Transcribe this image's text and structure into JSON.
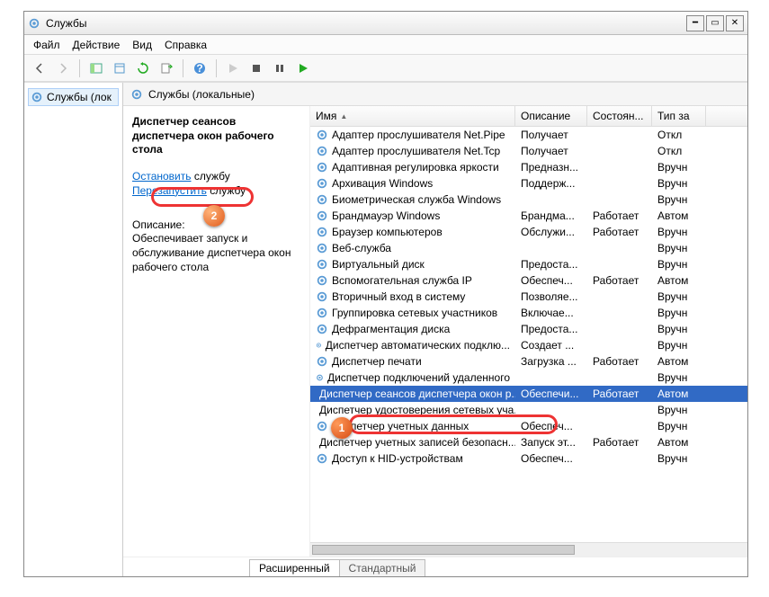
{
  "window": {
    "title": "Службы"
  },
  "menu": {
    "file": "Файл",
    "action": "Действие",
    "view": "Вид",
    "help": "Справка"
  },
  "tree": {
    "root": "Службы (лок"
  },
  "content_header": "Службы (локальные)",
  "detail": {
    "service_title": "Диспетчер сеансов диспетчера окон рабочего стола",
    "stop_prefix": "Остановить",
    "stop_suffix": " службу",
    "restart_prefix": "Перезапустить",
    "restart_suffix": " службу",
    "desc_label": "Описание:",
    "desc_text": "Обеспечивает запуск и обслуживание диспетчера окон рабочего стола"
  },
  "columns": {
    "name": "Имя",
    "desc": "Описание",
    "state": "Состоян...",
    "type": "Тип за"
  },
  "services": [
    {
      "name": "Адаптер прослушивателя Net.Pipe",
      "desc": "Получает",
      "state": "",
      "type": "Откл"
    },
    {
      "name": "Адаптер прослушивателя Net.Tcp",
      "desc": "Получает",
      "state": "",
      "type": "Откл"
    },
    {
      "name": "Адаптивная регулировка яркости",
      "desc": "Предназн...",
      "state": "",
      "type": "Вручн"
    },
    {
      "name": "Архивация Windows",
      "desc": "Поддерж...",
      "state": "",
      "type": "Вручн"
    },
    {
      "name": "Биометрическая служба Windows",
      "desc": "",
      "state": "",
      "type": "Вручн"
    },
    {
      "name": "Брандмауэр Windows",
      "desc": "Брандма...",
      "state": "Работает",
      "type": "Автом"
    },
    {
      "name": "Браузер компьютеров",
      "desc": "Обслужи...",
      "state": "Работает",
      "type": "Вручн"
    },
    {
      "name": "Веб-служба",
      "desc": "",
      "state": "",
      "type": "Вручн"
    },
    {
      "name": "Виртуальный диск",
      "desc": "Предоста...",
      "state": "",
      "type": "Вручн"
    },
    {
      "name": "Вспомогательная служба IP",
      "desc": "Обеспеч...",
      "state": "Работает",
      "type": "Автом"
    },
    {
      "name": "Вторичный вход в систему",
      "desc": "Позволяе...",
      "state": "",
      "type": "Вручн"
    },
    {
      "name": "Группировка сетевых участников",
      "desc": "Включае...",
      "state": "",
      "type": "Вручн"
    },
    {
      "name": "Дефрагментация диска",
      "desc": "Предоста...",
      "state": "",
      "type": "Вручн"
    },
    {
      "name": "Диспетчер автоматических подклю...",
      "desc": "Создает ...",
      "state": "",
      "type": "Вручн"
    },
    {
      "name": "Диспетчер печати",
      "desc": "Загрузка ...",
      "state": "Работает",
      "type": "Автом"
    },
    {
      "name": "Диспетчер подключений удаленного",
      "desc": "",
      "state": "",
      "type": "Вручн"
    },
    {
      "name": "Диспетчер сеансов диспетчера окон р...",
      "desc": "Обеспечи...",
      "state": "Работает",
      "type": "Автом",
      "selected": true
    },
    {
      "name": "Диспетчер удостоверения сетевых уча...",
      "desc": "",
      "state": "",
      "type": "Вручн"
    },
    {
      "name": "Диспетчер учетных данных",
      "desc": "Обеспеч...",
      "state": "",
      "type": "Вручн"
    },
    {
      "name": "Диспетчер учетных записей безопасн...",
      "desc": "Запуск эт...",
      "state": "Работает",
      "type": "Автом"
    },
    {
      "name": "Доступ к HID-устройствам",
      "desc": "Обеспеч...",
      "state": "",
      "type": "Вручн"
    }
  ],
  "tabs": {
    "extended": "Расширенный",
    "standard": "Стандартный"
  },
  "badges": {
    "one": "1",
    "two": "2"
  }
}
